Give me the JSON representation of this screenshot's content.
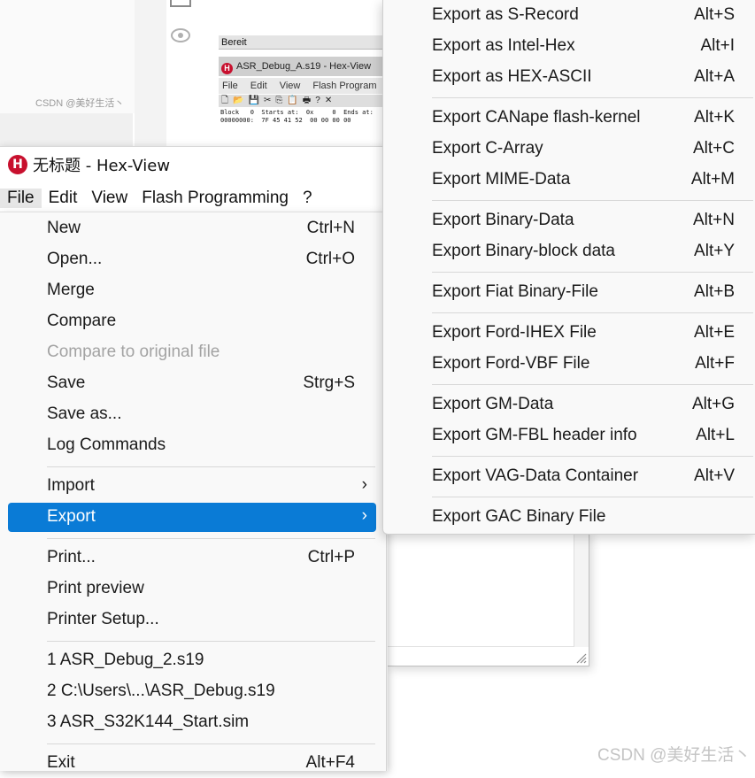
{
  "background": {
    "watermark_small": "CSDN @美好生活丶",
    "mini_window": {
      "status": "Bereit",
      "title": "ASR_Debug_A.s19 - Hex-View",
      "logo_letter": "H",
      "menu": [
        "File",
        "Edit",
        "View",
        "Flash Program"
      ],
      "toolbar_glyphs": [
        "🗋",
        "📂",
        "💾",
        "✂",
        "⎘",
        "📋",
        "🖶",
        "?",
        "✕"
      ],
      "data_line1": "Block   0  Starts at:  0x     0  Ends at:",
      "data_line2": "00000000:  7F 45 41 52  00 00 00 00"
    }
  },
  "app": {
    "logo_letter": "H",
    "title": "无标题 - Hex-View",
    "menubar": [
      {
        "label": "File",
        "active": true
      },
      {
        "label": "Edit",
        "active": false
      },
      {
        "label": "View",
        "active": false
      },
      {
        "label": "Flash Programming",
        "active": false
      },
      {
        "label": "?",
        "active": false
      }
    ]
  },
  "file_menu": {
    "items": [
      {
        "label": "New",
        "shortcut": "Ctrl+N"
      },
      {
        "label": "Open...",
        "shortcut": "Ctrl+O"
      },
      {
        "label": "Merge",
        "shortcut": ""
      },
      {
        "label": "Compare",
        "shortcut": ""
      },
      {
        "label": "Compare to original file",
        "shortcut": "",
        "disabled": true
      },
      {
        "label": "Save",
        "shortcut": "Strg+S"
      },
      {
        "label": "Save as...",
        "shortcut": ""
      },
      {
        "label": "Log Commands",
        "shortcut": ""
      },
      {
        "label": "Import",
        "submenu_arrow": "›"
      },
      {
        "label": "Export",
        "submenu_arrow": "›",
        "selected": true
      },
      {
        "label": "Print...",
        "shortcut": "Ctrl+P"
      },
      {
        "label": "Print preview",
        "shortcut": ""
      },
      {
        "label": "Printer Setup...",
        "shortcut": ""
      },
      {
        "label": "1 ASR_Debug_2.s19",
        "shortcut": ""
      },
      {
        "label": "2 C:\\Users\\...\\ASR_Debug.s19",
        "shortcut": ""
      },
      {
        "label": "3 ASR_S32K144_Start.sim",
        "shortcut": ""
      },
      {
        "label": "Exit",
        "shortcut": "Alt+F4"
      }
    ]
  },
  "export_menu": {
    "items": [
      {
        "label": "Export as S-Record",
        "shortcut": "Alt+S"
      },
      {
        "label": "Export as Intel-Hex",
        "shortcut": "Alt+I"
      },
      {
        "label": "Export as HEX-ASCII",
        "shortcut": "Alt+A"
      },
      {
        "label": "Export CANape flash-kernel",
        "shortcut": "Alt+K"
      },
      {
        "label": "Export C-Array",
        "shortcut": "Alt+C"
      },
      {
        "label": "Export MIME-Data",
        "shortcut": "Alt+M"
      },
      {
        "label": "Export Binary-Data",
        "shortcut": "Alt+N"
      },
      {
        "label": "Export Binary-block data",
        "shortcut": "Alt+Y"
      },
      {
        "label": "Export Fiat Binary-File",
        "shortcut": "Alt+B"
      },
      {
        "label": "Export Ford-IHEX File",
        "shortcut": "Alt+E"
      },
      {
        "label": "Export Ford-VBF File",
        "shortcut": "Alt+F"
      },
      {
        "label": "Export GM-Data",
        "shortcut": "Alt+G"
      },
      {
        "label": "Export GM-FBL header info",
        "shortcut": "Alt+L"
      },
      {
        "label": "Export VAG-Data Container",
        "shortcut": "Alt+V"
      },
      {
        "label": "Export GAC Binary File",
        "shortcut": ""
      }
    ]
  },
  "watermark": "CSDN @美好生活丶",
  "colors": {
    "selection": "#0a7bd6",
    "logo_red": "#c8102e",
    "disabled_text": "#a3a3a3"
  }
}
